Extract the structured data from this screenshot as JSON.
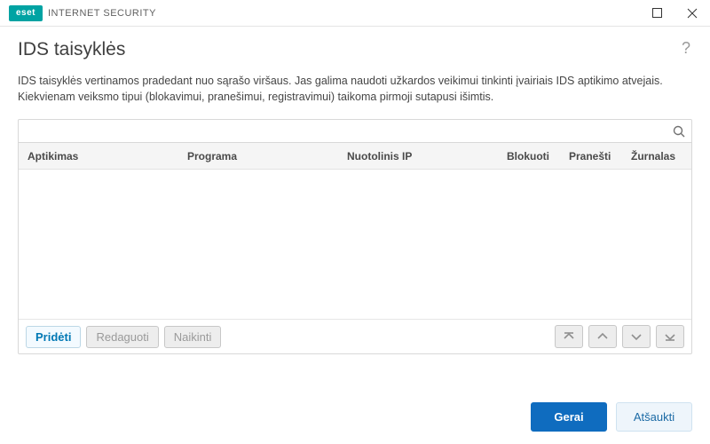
{
  "titlebar": {
    "brand_badge": "eset",
    "brand_text": "INTERNET SECURITY"
  },
  "page": {
    "title": "IDS taisyklės",
    "description": "IDS taisyklės vertinamos pradedant nuo sąrašo viršaus. Jas galima naudoti užkardos veikimui tinkinti įvairiais IDS aptikimo atvejais. Kiekvienam veiksmo tipui (blokavimui, pranešimui, registravimui) taikoma pirmoji sutapusi išimtis."
  },
  "search": {
    "placeholder": ""
  },
  "table": {
    "columns": {
      "detection": "Aptikimas",
      "application": "Programa",
      "remote_ip": "Nuotolinis IP",
      "block": "Blokuoti",
      "notify": "Pranešti",
      "log": "Žurnalas"
    },
    "rows": []
  },
  "panel_actions": {
    "add": "Pridėti",
    "edit": "Redaguoti",
    "delete": "Naikinti"
  },
  "dialog_actions": {
    "ok": "Gerai",
    "cancel": "Atšaukti"
  }
}
